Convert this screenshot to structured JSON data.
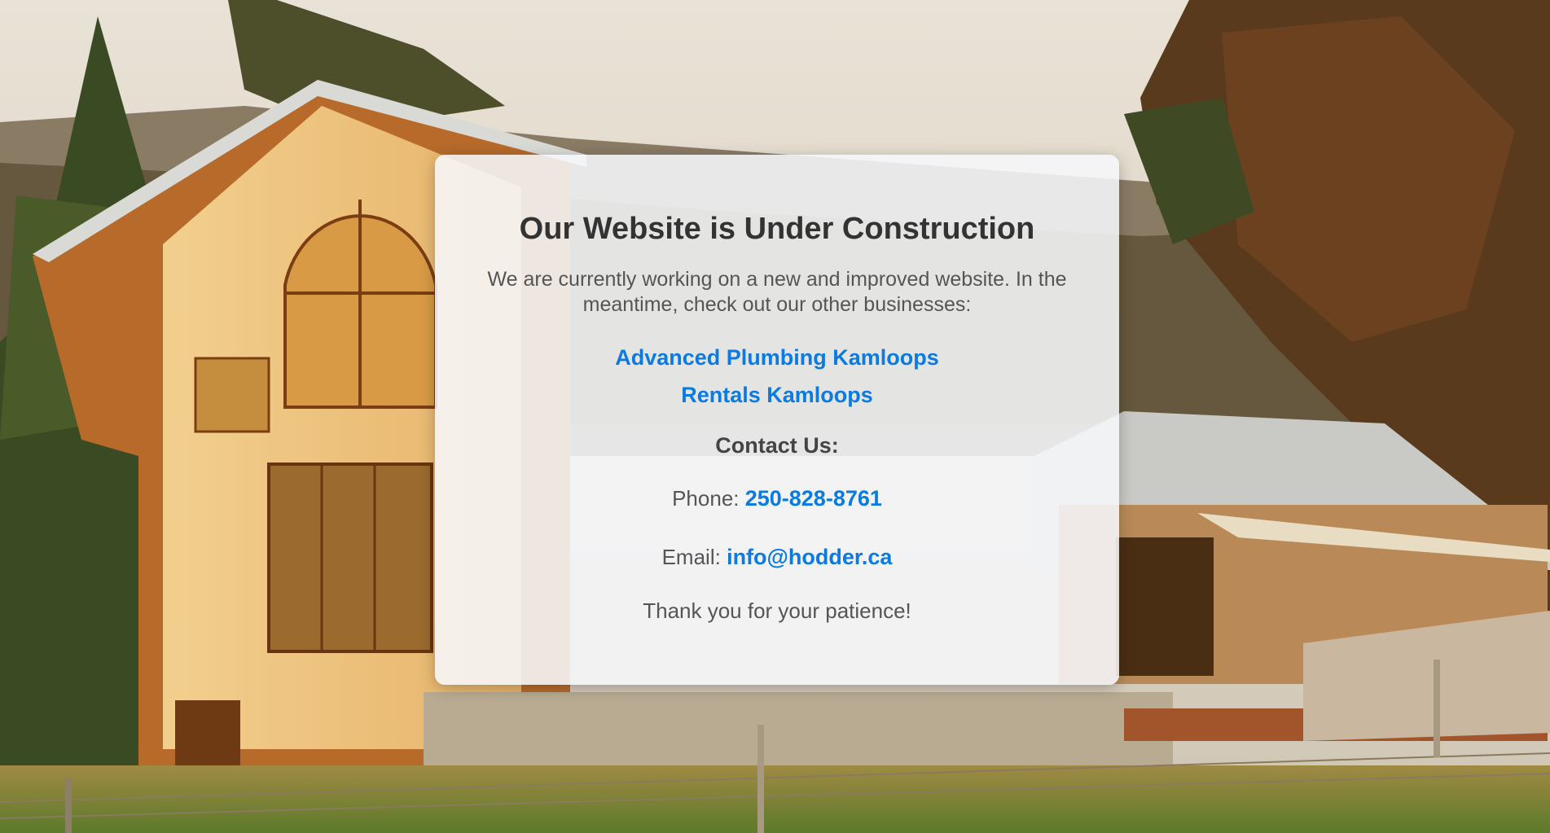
{
  "page": {
    "title": "Our Website is Under Construction",
    "intro": "We are currently working on a new and improved website. In the meantime, check out our other businesses:",
    "businesses": [
      {
        "label": "Advanced Plumbing Kamloops"
      },
      {
        "label": "Rentals Kamloops"
      }
    ],
    "contact_heading": "Contact Us:",
    "phone_label": "Phone:",
    "phone_value": "250-828-8761",
    "email_label": "Email:",
    "email_value": "info@hodder.ca",
    "thanks": "Thank you for your patience!"
  },
  "colors": {
    "link": "#0a7ae4",
    "heading": "#333333",
    "body_text": "#555555",
    "card_background": "#f6f7fa"
  },
  "background_image": {
    "subject": "timber-frame house in pine forest at sunset"
  }
}
